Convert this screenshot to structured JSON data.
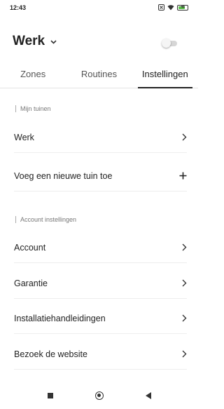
{
  "status_bar": {
    "time": "12:43",
    "battery": "48"
  },
  "header": {
    "garden_name": "Werk"
  },
  "tabs": [
    {
      "label": "Zones"
    },
    {
      "label": "Routines"
    },
    {
      "label": "Instellingen"
    }
  ],
  "gardens_section": {
    "title": "Mijn tuinen",
    "items": [
      {
        "label": "Werk"
      },
      {
        "label": "Voeg een nieuwe tuin toe"
      }
    ]
  },
  "account_section": {
    "title": "Account instellingen",
    "items": [
      {
        "label": "Account"
      },
      {
        "label": "Garantie"
      },
      {
        "label": "Installatiehandleidingen"
      },
      {
        "label": "Bezoek de website"
      }
    ]
  },
  "icons": {
    "chevron": "chevron-right-icon",
    "plus": "plus-icon",
    "dropdown": "chevron-down-icon"
  },
  "colors": {
    "battery": "#5bbf4a",
    "active_tab_indicator": "#222222"
  }
}
